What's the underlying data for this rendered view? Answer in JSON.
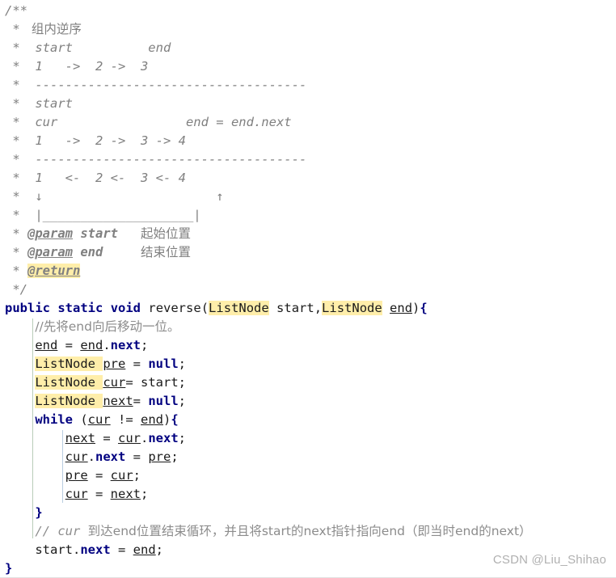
{
  "editor": {
    "background": "#ffffff",
    "keyword_color": "#000080",
    "comment_color": "#808080",
    "highlight_color": "#ffeeaa",
    "text_color": "#1a1a1a"
  },
  "javadoc": {
    "open": "/**",
    "lines": [
      {
        "star": "*",
        "text": " 组内逆序",
        "style": "cjk"
      },
      {
        "star": "*",
        "text": " start          end",
        "style": "italic"
      },
      {
        "star": "*",
        "text": " 1   ->  2 ->  3",
        "style": "italic"
      },
      {
        "star": "*",
        "text": " ------------------------------------",
        "style": "italic"
      },
      {
        "star": "*",
        "text": " start",
        "style": "italic"
      },
      {
        "star": "*",
        "text": " cur                 end = end.next",
        "style": "italic"
      },
      {
        "star": "*",
        "text": " 1   ->  2 ->  3 -> 4",
        "style": "italic"
      },
      {
        "star": "*",
        "text": " ------------------------------------",
        "style": "italic"
      },
      {
        "star": "*",
        "text": " 1   <-  2 <-  3 <- 4",
        "style": "italic"
      },
      {
        "star": "*",
        "text": " ↓                       ↑",
        "style": "italic"
      },
      {
        "star": "*",
        "text": " |____________________|",
        "style": "italic"
      }
    ],
    "param_start": {
      "star": "*",
      "tag": "@param",
      "name": "start",
      "desc": "起始位置"
    },
    "param_end": {
      "star": "*",
      "tag": "@param",
      "name": "end",
      "desc": "结束位置"
    },
    "return_tag": {
      "star": "*",
      "tag": "@return"
    },
    "close": "*/"
  },
  "signature": {
    "kw_public": "public",
    "kw_static": "static",
    "kw_void": "void",
    "method_name": "reverse",
    "paren_open": "(",
    "type1": "ListNode",
    "param1": "start",
    "comma": ",",
    "type2": "ListNode",
    "param2": "end",
    "paren_close": ")",
    "brace_open": "{"
  },
  "body": {
    "comment_move_end": "//先将end向后移动一位。",
    "stmt_end_assign": {
      "lhs": "end",
      "op": " = ",
      "obj": "end",
      "dot": ".",
      "field": "next",
      "semi": ";"
    },
    "decl_pre": {
      "type": "ListNode",
      "name": "pre",
      "op": " = ",
      "value": "null",
      "semi": ";"
    },
    "decl_cur": {
      "type": "ListNode",
      "name": "cur",
      "op": "= ",
      "value": "start",
      "semi": ";"
    },
    "decl_next": {
      "type": "ListNode",
      "name": "next",
      "op": "= ",
      "value": "null",
      "semi": ";"
    },
    "while_stmt": {
      "kw": "while",
      "space": " (",
      "lhs": "cur",
      "op": " != ",
      "rhs": "end",
      "close": ")",
      "brace": "{"
    },
    "loop_next": {
      "lhs": "next",
      "op": " = ",
      "obj": "cur",
      "dot": ".",
      "field": "next",
      "semi": ";"
    },
    "loop_curnext": {
      "obj": "cur",
      "dot": ".",
      "field": "next",
      "op": " = ",
      "rhs": "pre",
      "semi": ";"
    },
    "loop_pre": {
      "lhs": "pre",
      "op": " = ",
      "rhs": "cur",
      "semi": ";"
    },
    "loop_cur": {
      "lhs": "cur",
      "op": " = ",
      "rhs": "next",
      "semi": ";"
    },
    "brace_close_while": "}",
    "comment_tail_a": "// ",
    "comment_tail_b": "cur ",
    "comment_tail_c": "到达end位置结束循环，并且将start的next指针指向end（即当时end的next）",
    "stmt_start_next": {
      "obj": "start",
      "dot": ".",
      "field": "next",
      "op": " = ",
      "rhs": "end",
      "semi": ";"
    },
    "brace_close_method": "}"
  },
  "watermark": {
    "text": "CSDN @Liu_Shihao"
  }
}
